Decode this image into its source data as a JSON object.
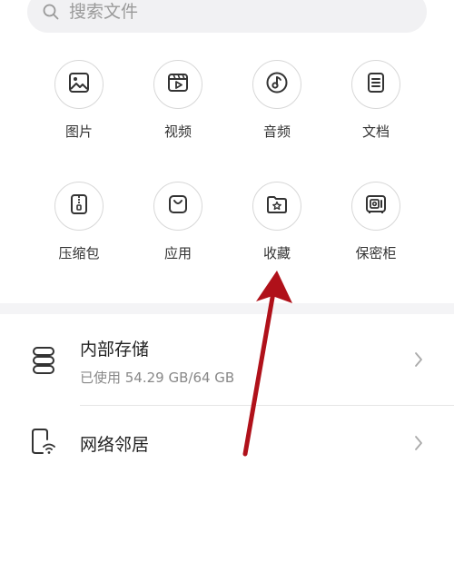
{
  "search": {
    "placeholder": "搜索文件",
    "icon": "search-icon"
  },
  "categories": [
    {
      "label": "图片",
      "icon": "image-icon"
    },
    {
      "label": "视频",
      "icon": "video-icon"
    },
    {
      "label": "音频",
      "icon": "audio-icon"
    },
    {
      "label": "文档",
      "icon": "document-icon"
    },
    {
      "label": "压缩包",
      "icon": "zip-icon"
    },
    {
      "label": "应用",
      "icon": "app-bag-icon"
    },
    {
      "label": "收藏",
      "icon": "favorites-folder-icon"
    },
    {
      "label": "保密柜",
      "icon": "safe-icon"
    }
  ],
  "storage": {
    "internal": {
      "title": "内部存储",
      "usage": "已使用 54.29 GB/64 GB",
      "icon": "storage-icon"
    },
    "network": {
      "title": "网络邻居",
      "icon": "network-device-icon"
    }
  },
  "colors": {
    "icon_stroke": "#333333",
    "annotation_arrow": "#b0111a",
    "band": "#f4f4f6"
  }
}
